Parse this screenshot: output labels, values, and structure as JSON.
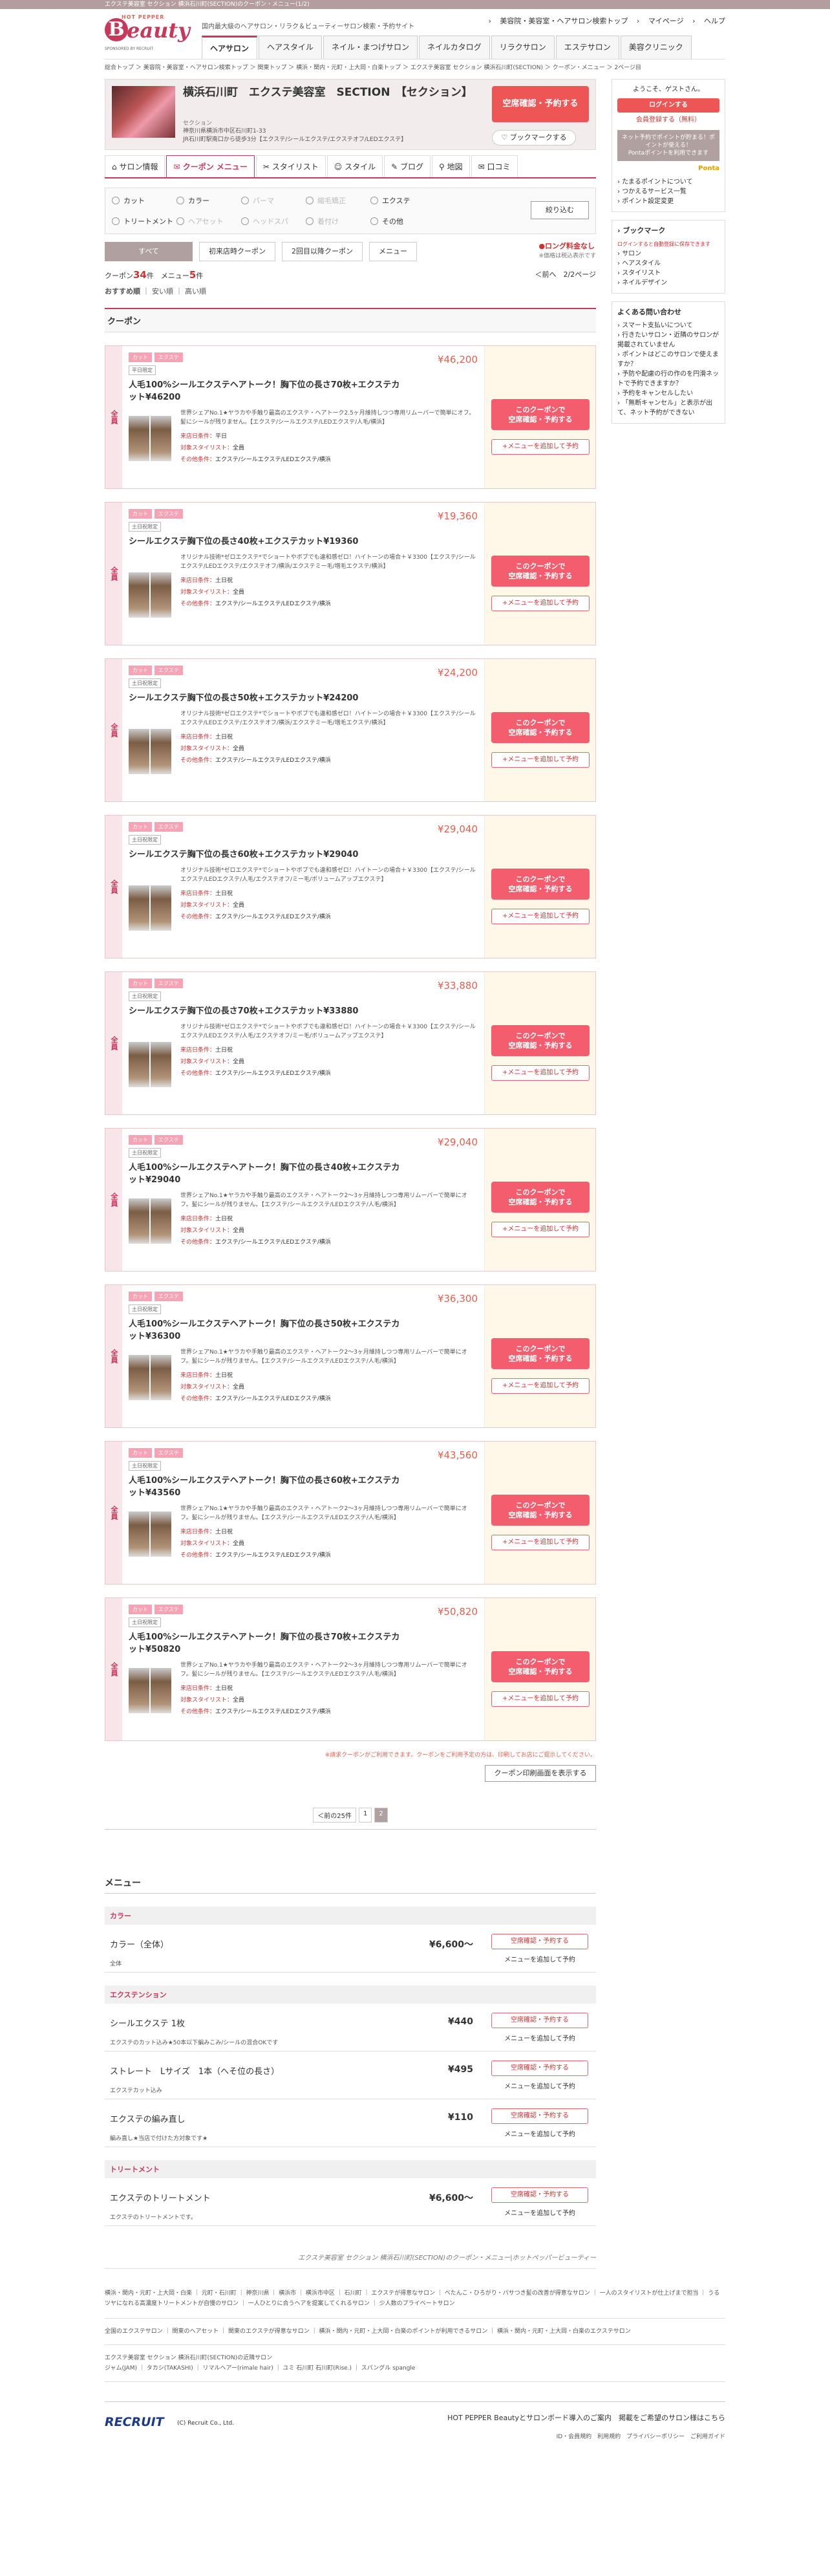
{
  "topbar": {
    "text": "エクステ美容室 セクション 横浜石川町(SECTION)のクーポン・メニュー(1/2)"
  },
  "header": {
    "logo_hp": "HOT PEPPER",
    "logo_b": "B",
    "logo_rest": "eauty",
    "logo_sub": "SPONSORED BY RECRUIT",
    "tagline": "国内最大級のヘアサロン・リラク＆ビューティーサロン検索・予約サイト",
    "links": [
      "美容院・美容室・ヘアサロン検索トップ",
      "マイページ",
      "ヘルプ"
    ],
    "nav": [
      "ヘアサロン",
      "ヘアスタイル",
      "ネイル・まつげサロン",
      "ネイルカタログ",
      "リラクサロン",
      "エステサロン",
      "美容クリニック"
    ]
  },
  "breadcrumb": "総合トップ ＞ 美容院・美容室・ヘアサロン検索トップ ＞ 関東トップ ＞ 横浜・関内・元町・上大岡・白楽トップ ＞ エクステ美容室 セクション 横浜石川町(SECTION) ＞ クーポン・メニュー ＞ 2ページ目",
  "shop": {
    "name": "横浜石川町　エクステ美容室　SECTION　【セクション】",
    "kana": "セクション",
    "address": "神奈川県横浜市中区石川町1-33",
    "access": "JR石川町駅南口から徒歩3分【エクステ/シールエクステ/エクステオフ/LEDエクステ】",
    "reserve_label": "空席確認・予約する",
    "bookmark_label": "ブックマークする"
  },
  "subnav": [
    "サロン情報",
    "クーポン メニュー",
    "スタイリスト",
    "スタイル",
    "ブログ",
    "地図",
    "口コミ"
  ],
  "filter": {
    "items": [
      {
        "label": "カット",
        "disabled": false
      },
      {
        "label": "カラー",
        "disabled": false
      },
      {
        "label": "パーマ",
        "disabled": true
      },
      {
        "label": "縮毛矯正",
        "disabled": true
      },
      {
        "label": "エクステ",
        "disabled": false
      },
      {
        "label": "トリートメント",
        "disabled": false
      },
      {
        "label": "ヘアセット",
        "disabled": true
      },
      {
        "label": "ヘッドスパ",
        "disabled": true
      },
      {
        "label": "着付け",
        "disabled": true
      },
      {
        "label": "その他",
        "disabled": false
      }
    ],
    "narrow_label": "絞り込む"
  },
  "tabs": {
    "all": "すべて",
    "first": "初来店時クーポン",
    "second": "2回目以降クーポン",
    "menu": "メニュー",
    "rong1": "●ロング料金なし",
    "rong2": "※価格は税込表示です"
  },
  "counts": {
    "coupon_label": "クーポン",
    "coupon_num": "34",
    "coupon_unit": "件",
    "menu_label": "メニュー",
    "menu_num": "5",
    "menu_unit": "件",
    "prev": "＜前へ",
    "page": "2/2ページ"
  },
  "sort": {
    "label": "おすすめ順",
    "a": "安い順",
    "b": "高い順"
  },
  "coupon_section": "クーポン",
  "coupons": [
    {
      "badges": [
        "カット",
        "エクステ"
      ],
      "cond": "平日限定",
      "price": "¥46,200",
      "title": "人毛100%シールエクステヘアトーク！胸下位の長さ70枚+エクステカット¥46200",
      "desc": "世界シェアNo.1★ヤラカや手触り最高のエクステ・ヘアトーク2.5ヶ月維持しつつ専用リムーバーで簡単にオフ。髪にシールが残りません。【エクステ/シールエクステ/LEDエクステ/人毛/横浜】",
      "k1": "来店日条件：",
      "v1": "平日",
      "k2": "対象スタイリスト：",
      "v2": "全員",
      "k3": "その他条件：",
      "v3": "エクステ/シールエクステ/LEDエクステ/横浜"
    },
    {
      "badges": [
        "カット",
        "エクステ"
      ],
      "cond": "土日祝限定",
      "price": "¥19,360",
      "title": "シールエクステ胸下位の長さ40枚+エクステカット¥19360",
      "desc": "オリジナル技術*ゼロエクステ*でショートやボブでも違和感ゼロ！ハイトーンの場合＋￥3300【エクステ/シールエクステ/LEDエクステ/エクステオフ/横浜/エクステミー毛/増毛エクステ/横浜】",
      "k1": "来店日条件：",
      "v1": "土日祝",
      "k2": "対象スタイリスト：",
      "v2": "全員",
      "k3": "その他条件：",
      "v3": "エクステ/シールエクステ/LEDエクステ/横浜"
    },
    {
      "badges": [
        "カット",
        "エクステ"
      ],
      "cond": "土日祝限定",
      "price": "¥24,200",
      "title": "シールエクステ胸下位の長さ50枚+エクステカット¥24200",
      "desc": "オリジナル技術*ゼロエクステ*でショートやボブでも違和感ゼロ！ハイトーンの場合＋￥3300【エクステ/シールエクステ/LEDエクステ/エクステオフ/横浜/エクステミー毛/増毛エクステ/横浜】",
      "k1": "来店日条件：",
      "v1": "土日祝",
      "k2": "対象スタイリスト：",
      "v2": "全員",
      "k3": "その他条件：",
      "v3": "エクステ/シールエクステ/LEDエクステ/横浜"
    },
    {
      "badges": [
        "カット",
        "エクステ"
      ],
      "cond": "土日祝限定",
      "price": "¥29,040",
      "title": "シールエクステ胸下位の長さ60枚+エクステカット¥29040",
      "desc": "オリジナル技術*ゼロエクステ*でショートやボブでも違和感ゼロ！ハイトーンの場合＋￥3300【エクステ/シールエクステ/LEDエクステ/人毛/エクステオフ/ミー毛/ボリュームアップエクステ】",
      "k1": "来店日条件：",
      "v1": "土日祝",
      "k2": "対象スタイリスト：",
      "v2": "全員",
      "k3": "その他条件：",
      "v3": "エクステ/シールエクステ/LEDエクステ/横浜"
    },
    {
      "badges": [
        "カット",
        "エクステ"
      ],
      "cond": "土日祝限定",
      "price": "¥33,880",
      "title": "シールエクステ胸下位の長さ70枚+エクステカット¥33880",
      "desc": "オリジナル技術*ゼロエクステ*でショートやボブでも違和感ゼロ！ハイトーンの場合＋￥3300【エクステ/シールエクステ/LEDエクステ/人毛/エクステオフ/ミー毛/ボリュームアップエクステ】",
      "k1": "来店日条件：",
      "v1": "土日祝",
      "k2": "対象スタイリスト：",
      "v2": "全員",
      "k3": "その他条件：",
      "v3": "エクステ/シールエクステ/LEDエクステ/横浜"
    },
    {
      "badges": [
        "カット",
        "エクステ"
      ],
      "cond": "土日祝限定",
      "price": "¥29,040",
      "title": "人毛100%シールエクステヘアトーク！胸下位の長さ40枚+エクステカット¥29040",
      "desc": "世界シェアNo.1★ヤラカや手触り最高のエクステ・ヘアトーク2〜3ヶ月維持しつつ専用リムーバーで簡単にオフ。髪にシールが残りません。【エクステ/シールエクステ/LEDエクステ/人毛/横浜】",
      "k1": "来店日条件：",
      "v1": "土日祝",
      "k2": "対象スタイリスト：",
      "v2": "全員",
      "k3": "その他条件：",
      "v3": "エクステ/シールエクステ/LEDエクステ/横浜"
    },
    {
      "badges": [
        "カット",
        "エクステ"
      ],
      "cond": "土日祝限定",
      "price": "¥36,300",
      "title": "人毛100%シールエクステヘアトーク！胸下位の長さ50枚+エクステカット¥36300",
      "desc": "世界シェアNo.1★ヤラカや手触り最高のエクステ・ヘアトーク2〜3ヶ月維持しつつ専用リムーバーで簡単にオフ。髪にシールが残りません。【エクステ/シールエクステ/LEDエクステ/人毛/横浜】",
      "k1": "来店日条件：",
      "v1": "土日祝",
      "k2": "対象スタイリスト：",
      "v2": "全員",
      "k3": "その他条件：",
      "v3": "エクステ/シールエクステ/LEDエクステ/横浜"
    },
    {
      "badges": [
        "カット",
        "エクステ"
      ],
      "cond": "土日祝限定",
      "price": "¥43,560",
      "title": "人毛100%シールエクステヘアトーク！胸下位の長さ60枚+エクステカット¥43560",
      "desc": "世界シェアNo.1★ヤラカや手触り最高のエクステ・ヘアトーク2〜3ヶ月維持しつつ専用リムーバーで簡単にオフ。髪にシールが残りません。【エクステ/シールエクステ/LEDエクステ/人毛/横浜】",
      "k1": "来店日条件：",
      "v1": "土日祝",
      "k2": "対象スタイリスト：",
      "v2": "全員",
      "k3": "その他条件：",
      "v3": "エクステ/シールエクステ/LEDエクステ/横浜"
    },
    {
      "badges": [
        "カット",
        "エクステ"
      ],
      "cond": "土日祝限定",
      "price": "¥50,820",
      "title": "人毛100%シールエクステヘアトーク！胸下位の長さ70枚+エクステカット¥50820",
      "desc": "世界シェアNo.1★ヤラカや手触り最高のエクステ・ヘアトーク2〜3ヶ月維持しつつ専用リムーバーで簡単にオフ。髪にシールが残りません。【エクステ/シールエクステ/LEDエクステ/人毛/横浜】",
      "k1": "来店日条件：",
      "v1": "土日祝",
      "k2": "対象スタイリスト：",
      "v2": "全員",
      "k3": "その他条件：",
      "v3": "エクステ/シールエクステ/LEDエクステ/横浜"
    }
  ],
  "coupon_side": "全員",
  "coupon_btn": "このクーポンで\n空席確認・予約する",
  "coupon_add": "+メニューを追加して予約",
  "note": "※請求クーポンがご利用できます。クーポンをご利用予定の方は、印刷してお店にご提示してください。",
  "print_label": "クーポン印刷画面を表示する",
  "pager": {
    "prev": "＜前の25件",
    "p1": "1",
    "p2": "2"
  },
  "menu_title": "メニュー",
  "menu_cats": [
    {
      "cat": "カラー",
      "items": [
        {
          "name": "カラー（全体）",
          "price": "¥6,600〜",
          "desc": "全体"
        }
      ]
    },
    {
      "cat": "エクステンション",
      "items": [
        {
          "name": "シールエクステ 1枚",
          "price": "¥440",
          "desc": "エクステのカット込み★50本以下編みこみ/シールの混合OKです"
        },
        {
          "name": "ストレート　Lサイズ　1本（へそ位の長さ）",
          "price": "¥495",
          "desc": "エクステカット込み"
        },
        {
          "name": "エクステの編み直し",
          "price": "¥110",
          "desc": "編み直し★当店で付けた方対象です★"
        }
      ]
    },
    {
      "cat": "トリートメント",
      "items": [
        {
          "name": "エクステのトリートメント",
          "price": "¥6,600〜",
          "desc": "エクステのトリートメントです。"
        }
      ]
    }
  ],
  "menu_btn1": "空席確認・予約する",
  "menu_btn2": "メニューを追加して予約",
  "crumbline": "エクステ美容室 セクション 横浜石川町(SECTION)のクーポン・メニュー|ホットペッパービューティー",
  "footer": {
    "links1": "横浜・関内・元町・上大岡・白楽 ｜ 元町・石川町 ｜ 神奈川県 ｜ 横浜市 ｜ 横浜市中区 ｜ 石川町 ｜ エクステが得意なサロン ｜ ベたんこ・ひろがり・パサつき髪の改善が得意なサロン ｜ 一人のスタイリストが仕上げまで担当 ｜ うるツヤになれる高濃度トリートメントが自慢のサロン ｜ 一人ひとりに合うヘアを提案してくれるサロン ｜ 少人数のプライベートサロン",
    "links2": "全国のエクステサロン ｜ 関東のヘアセット ｜ 関東のエクステが得意なサロン ｜ 横浜・関内・元町・上大岡・白楽のポイントが利用できるサロン ｜ 横浜・関内・元町・上大岡・白楽のエクステサロン",
    "links3": "エクステ美容室 セクション 横浜石川町(SECTION)の近隣サロン\nジャム(JAM) ｜ タカシ(TAKASHI) ｜ リマルヘアー(rimale hair) ｜ ユミ 石川町 石川町(Rise.) ｜ スパングル spangle",
    "recruit": "RECRUIT",
    "copyright": "(C) Recruit Co., Ltd.",
    "right1": "HOT PEPPER Beautyとサロンボード導入のご案内　掲載をご希望のサロン様はこちら",
    "right2": "ID・会員規約　利用規約　プライバシーポリシー　ご利用ガイド"
  },
  "sidebar": {
    "welcome": "ようこそ、ゲストさん。",
    "login": "ログインする",
    "register": "会員登録する（無料）",
    "point_text": "ネット予約でポイントが貯まる！ポイントが使える！",
    "point_text2": "Pontaポイントを利用できます",
    "point_brand": "Ponta",
    "list": [
      "たまるポイントについて",
      "つかえるサービス一覧",
      "ポイント設定変更"
    ],
    "bookmark_title": "ブックマーク",
    "bookmark_note": "ログインすると自動登録に保存できます",
    "bookmark_items": [
      "サロン",
      "ヘアスタイル",
      "スタイリスト",
      "ネイルデザイン"
    ],
    "faq_title": "よくある問い合わせ",
    "faq": [
      "スマート支払いについて",
      "行きたいサロン・近隣のサロンが掲載されていません",
      "ポイントはどこのサロンで使えますか？",
      "予防や配慮の行の作のを円滑ネットで予約できますか？",
      "予約をキャンセルしたい",
      "「無断キャンセル」と表示が出て、ネット予約ができない"
    ]
  }
}
